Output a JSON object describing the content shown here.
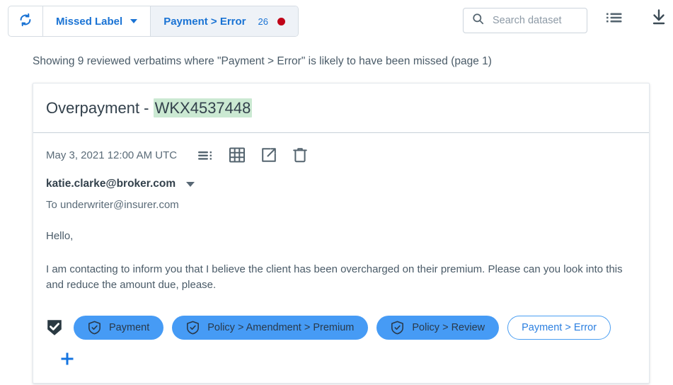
{
  "topbar": {
    "refresh_icon": "refresh-icon",
    "filter_label": "Missed Label",
    "active_label": "Payment > Error",
    "active_count": "26",
    "status_dot_color": "#c00418",
    "search_placeholder": "Search dataset",
    "search_value": "",
    "search_icon": "search-icon",
    "list_view_icon": "list-view-icon",
    "download_icon": "download-icon"
  },
  "caption": "Showing 9 reviewed verbatims where \"Payment > Error\" is likely to have been missed (page 1)",
  "card": {
    "title_prefix": "Overpayment - ",
    "title_highlight": "WKX4537448",
    "highlight_color": "#cbe9d2",
    "date": "May 3, 2021 12:00 AM UTC",
    "actions": [
      {
        "name": "text-lines-icon"
      },
      {
        "name": "grid-icon"
      },
      {
        "name": "open-external-icon"
      },
      {
        "name": "trash-icon"
      }
    ],
    "from": "katie.clarke@broker.com",
    "to": "To underwriter@insurer.com",
    "greeting": "Hello,",
    "body": "I am contacting to inform you that I believe the client has been overcharged on their premium. Please can you look into this and reduce the amount due, please.",
    "verified_icon": "shield-check-filled-icon",
    "labels": [
      {
        "text": "Payment",
        "style": "filled",
        "icon": "shield-check-icon"
      },
      {
        "text": "Policy > Amendment > Premium",
        "style": "filled",
        "icon": "shield-check-icon"
      },
      {
        "text": "Policy > Review",
        "style": "filled",
        "icon": "shield-check-icon"
      },
      {
        "text": "Payment > Error",
        "style": "outline",
        "icon": ""
      }
    ],
    "add_label_icon": "plus-icon"
  },
  "colors": {
    "accent_blue": "#1a73d4",
    "chip_blue": "#469bf5",
    "chip_outline_blue": "#4a9ef2",
    "icon_grey": "#566672"
  }
}
